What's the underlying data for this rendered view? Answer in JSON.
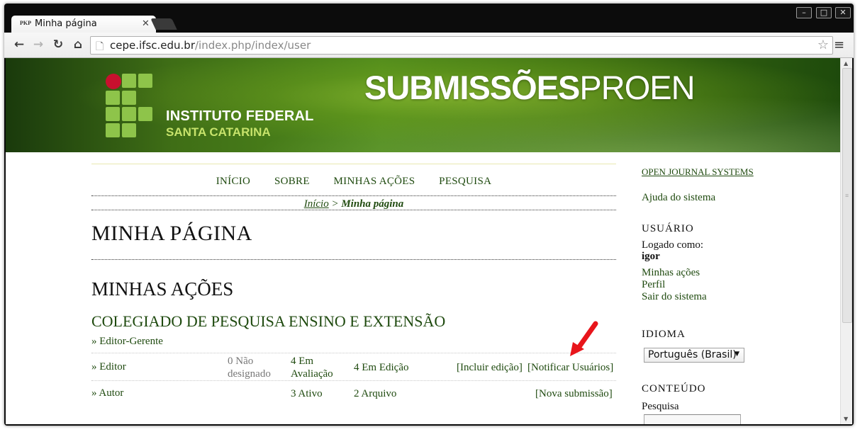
{
  "browser": {
    "tab_title": "Minha página",
    "tab_favicon": "PKP",
    "url_host": "cepe.ifsc.edu.br",
    "url_path": "/index.php/index/user"
  },
  "banner": {
    "institute_line1": "INSTITUTO FEDERAL",
    "institute_line2": "SANTA CATARINA",
    "brand_bold": "SUBMISSÕES",
    "brand_light": "PROEN"
  },
  "nav": {
    "items": [
      "INÍCIO",
      "SOBRE",
      "MINHAS AÇÕES",
      "PESQUISA"
    ]
  },
  "breadcrumb": {
    "home": "Início",
    "separator": ">",
    "current": "Minha página"
  },
  "page_title": "MINHA PÁGINA",
  "section_title": "MINHAS AÇÕES",
  "journal": {
    "name": "COLEGIADO DE PESQUISA ENSINO E EXTENSÃO",
    "roles": [
      {
        "label": "» Editor-Gerente"
      },
      {
        "label": "» Editor",
        "col1_line1": "0 Não",
        "col1_line2": "designado",
        "col2_line1": "4 Em",
        "col2_line2": "Avaliação",
        "col3": "4 Em Edição",
        "action1": "[Incluir edição]",
        "action2": "[Notificar Usuários]"
      },
      {
        "label": "» Autor",
        "col2": "3 Ativo",
        "col3": "2 Arquivo",
        "action": "[Nova submissão]"
      }
    ]
  },
  "sidebar": {
    "ojs": "OPEN JOURNAL SYSTEMS",
    "help": "Ajuda do sistema",
    "user_heading": "USUÁRIO",
    "logged_as": "Logado como:",
    "username": "igor",
    "links": [
      "Minhas ações",
      "Perfil",
      "Sair do sistema"
    ],
    "language_heading": "IDIOMA",
    "language_selected": "Português (Brasil)",
    "content_heading": "CONTEÚDO",
    "search_label": "Pesquisa"
  },
  "colors": {
    "link_green": "#1f4a0f",
    "logo_green": "#8ec44a",
    "logo_red": "#c8102e",
    "annotation_arrow": "#e8151b"
  }
}
